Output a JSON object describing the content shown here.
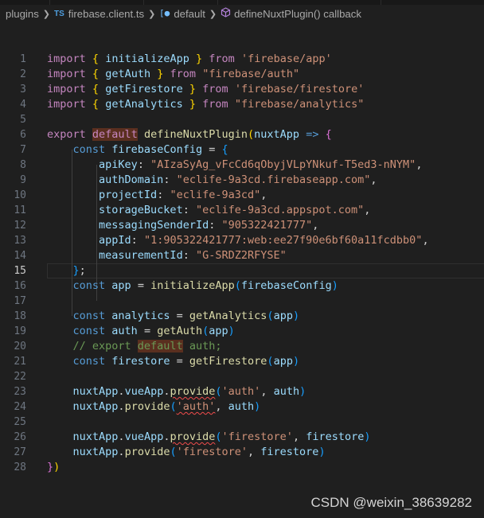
{
  "breadcrumb": {
    "folder": "plugins",
    "file_badge": "TS",
    "file": "firebase.client.ts",
    "symbol1": "default",
    "symbol2": "defineNuxtPlugin() callback"
  },
  "gutter": [
    "1",
    "2",
    "3",
    "4",
    "5",
    "6",
    "7",
    "8",
    "9",
    "10",
    "11",
    "12",
    "13",
    "14",
    "15",
    "16",
    "17",
    "18",
    "19",
    "20",
    "21",
    "22",
    "23",
    "24",
    "25",
    "26",
    "27",
    "28"
  ],
  "active_line": 15,
  "code": {
    "kw_import": "import",
    "kw_from": "from",
    "kw_export": "export",
    "kw_default": "default",
    "kw_const": "const",
    "arrow": "=>",
    "initializeApp": "initializeApp",
    "getAuth": "getAuth",
    "getFirestore": "getFirestore",
    "getAnalytics": "getAnalytics",
    "defineNuxtPlugin": "defineNuxtPlugin",
    "nuxtApp": "nuxtApp",
    "firebaseConfig": "firebaseConfig",
    "app": "app",
    "analytics": "analytics",
    "auth": "auth",
    "firestore": "firestore",
    "vueApp": "vueApp",
    "provide": "provide",
    "mod_app": "'firebase/app'",
    "mod_auth": "\"firebase/auth\"",
    "mod_firestore": "'firebase/firestore'",
    "mod_analytics": "\"firebase/analytics\"",
    "cfg_apiKey_key": "apiKey",
    "cfg_apiKey_val": "\"AIzaSyAg_vFcCd6qObyjVLpYNkuf-T5ed3-nNYM\"",
    "cfg_authDomain_key": "authDomain",
    "cfg_authDomain_val": "\"eclife-9a3cd.firebaseapp.com\"",
    "cfg_projectId_key": "projectId",
    "cfg_projectId_val": "\"eclife-9a3cd\"",
    "cfg_storageBucket_key": "storageBucket",
    "cfg_storageBucket_val": "\"eclife-9a3cd.appspot.com\"",
    "cfg_messagingSenderId_key": "messagingSenderId",
    "cfg_messagingSenderId_val": "\"905322421777\"",
    "cfg_appId_key": "appId",
    "cfg_appId_val": "\"1:905322421777:web:ee27f90e6bf60a11fcdbb0\"",
    "cfg_measurementId_key": "measurementId",
    "cfg_measurementId_val": "\"G-SRDZ2RFYSE\"",
    "comment_prefix": "// export ",
    "comment_default": "default",
    "comment_suffix": " auth;",
    "str_auth": "'auth'",
    "str_firestore": "'firestore'"
  },
  "watermark": "CSDN @weixin_38639282",
  "colors": {
    "background": "#1f1f1f",
    "keyword": "#c586c0",
    "storage": "#569cd6",
    "variable": "#9cdcfe",
    "function": "#dcdcaa",
    "string": "#ce9178",
    "comment": "#6a9955"
  }
}
